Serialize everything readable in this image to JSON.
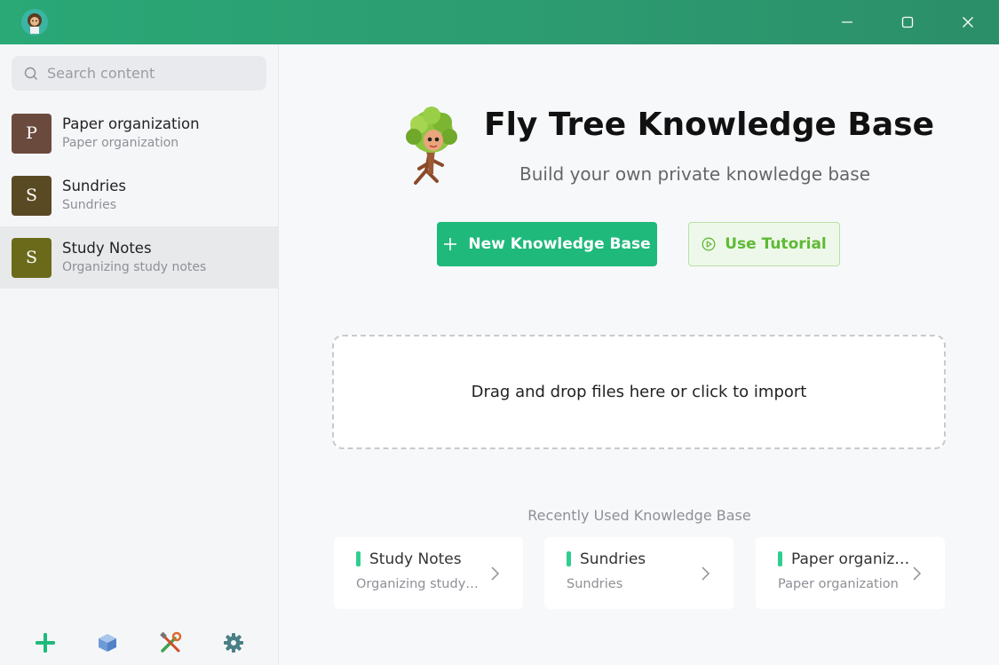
{
  "window": {
    "minimize_icon": "minimize-icon",
    "maximize_icon": "maximize-icon",
    "close_icon": "close-icon"
  },
  "sidebar": {
    "search": {
      "placeholder": "Search content",
      "value": ""
    },
    "items": [
      {
        "avatar": "P",
        "title": "Paper organization",
        "subtitle": "Paper organization",
        "color": "#6b4a3e"
      },
      {
        "avatar": "S",
        "title": "Sundries",
        "subtitle": "Sundries",
        "color": "#5a4a24"
      },
      {
        "avatar": "S",
        "title": "Study Notes",
        "subtitle": "Organizing study notes",
        "color": "#6b6a1a"
      }
    ],
    "active_index": 2,
    "bottom_icons": [
      "plus-icon",
      "cube-icon",
      "tools-icon",
      "gear-icon"
    ]
  },
  "main": {
    "title": "Fly Tree Knowledge Base",
    "subtitle": "Build your own private knowledge base",
    "new_button": "New Knowledge Base",
    "tutorial_button": "Use Tutorial",
    "dropzone_text": "Drag and drop files here or click to import",
    "recent_title": "Recently Used Knowledge Base",
    "recent": [
      {
        "name": "Study Notes",
        "desc": "Organizing study n..."
      },
      {
        "name": "Sundries",
        "desc": "Sundries"
      },
      {
        "name": "Paper organizat...",
        "desc": "Paper organization"
      }
    ]
  },
  "colors": {
    "accent": "#1fb97b",
    "titlebar": "#2aa876",
    "tutorial_text": "#5fba35"
  }
}
